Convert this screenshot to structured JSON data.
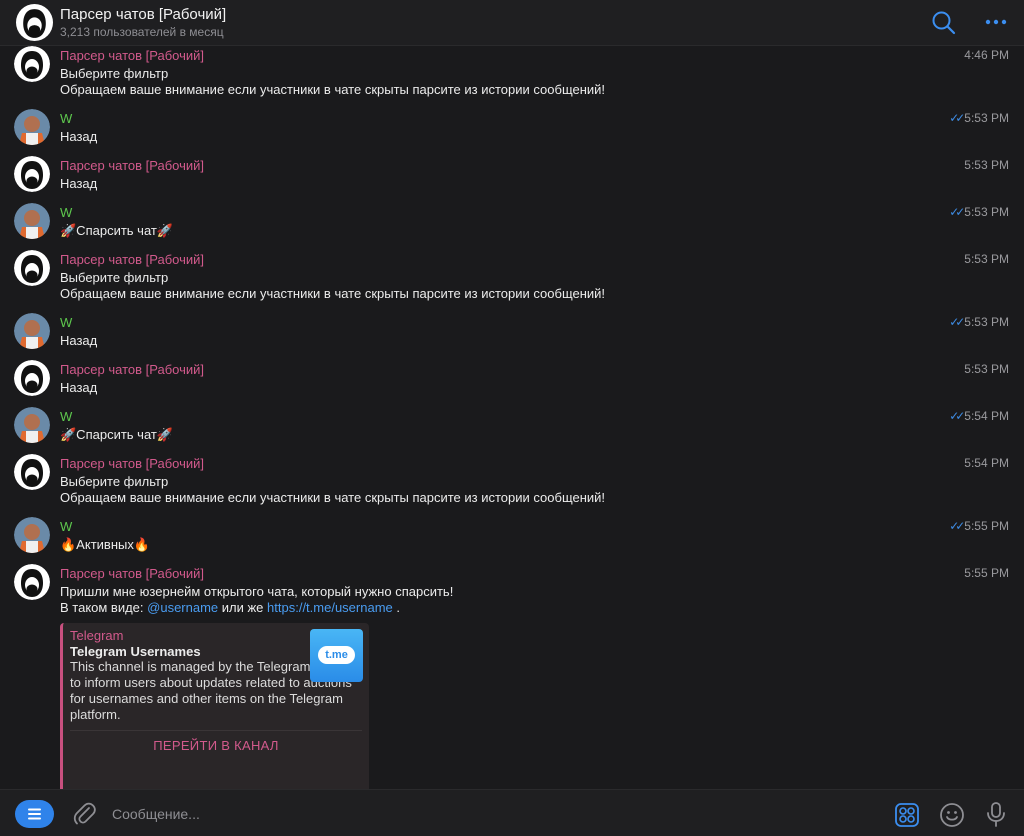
{
  "header": {
    "title": "Парсер чатов [Рабочий]",
    "subtitle": "3,213 пользователей в месяц",
    "icons": {
      "search": "search-icon",
      "more": "more-icon"
    }
  },
  "colors": {
    "accent": "#2f83ea",
    "bot_name": "#d25a8c",
    "user_name": "#5ec84e",
    "link": "#4a9cf0",
    "read_ticks": "#3e8ce4"
  },
  "messages": [
    {
      "sender": "Парсер чатов [Рабочий]",
      "time": "4:46 PM",
      "lines": [
        "Выберите фильтр",
        "Обращаем ваше внимание если участники в чате скрыты парсите из истории сообщений!"
      ]
    },
    {
      "sender": "W",
      "time": "5:53 PM",
      "lines": [
        "Назад"
      ]
    },
    {
      "sender": "Парсер чатов [Рабочий]",
      "time": "5:53 PM",
      "lines": [
        "Назад"
      ]
    },
    {
      "sender": "W",
      "time": "5:53 PM",
      "lines": [
        "🚀Спарсить чат🚀"
      ]
    },
    {
      "sender": "Парсер чатов [Рабочий]",
      "time": "5:53 PM",
      "lines": [
        "Выберите фильтр",
        "Обращаем ваше внимание если участники в чате скрыты парсите из истории сообщений!"
      ]
    },
    {
      "sender": "W",
      "time": "5:53 PM",
      "lines": [
        "Назад"
      ]
    },
    {
      "sender": "Парсер чатов [Рабочий]",
      "time": "5:53 PM",
      "lines": [
        "Назад"
      ]
    },
    {
      "sender": "W",
      "time": "5:54 PM",
      "lines": [
        "🚀Спарсить чат🚀"
      ]
    },
    {
      "sender": "Парсер чатов [Рабочий]",
      "time": "5:54 PM",
      "lines": [
        "Выберите фильтр",
        "Обращаем ваше внимание если участники в чате скрыты парсите из истории сообщений!"
      ]
    },
    {
      "sender": "W",
      "time": "5:55 PM",
      "lines": [
        "🔥Активных🔥"
      ]
    },
    {
      "sender": "Парсер чатов [Рабочий]",
      "time": "5:55 PM",
      "lines": [
        "Пришли мне юзернейм открытого чата, который нужно спарсить!"
      ],
      "line2": {
        "prefix": "В таком виде: ",
        "link1": "@username",
        "middle": " или же ",
        "link2": "https://t.me/username",
        "suffix": " ."
      }
    }
  ],
  "read_ticks": "✓✓",
  "preview": {
    "site": "Telegram",
    "title": "Telegram Usernames",
    "description": "This channel is managed by the Telegram team to inform users about updates related to auctions for usernames and other items on the Telegram platform.",
    "thumb_label": "t.me",
    "button": "ПЕРЕЙТИ В КАНАЛ"
  },
  "composer": {
    "placeholder": "Сообщение...",
    "icons": [
      "menu-icon",
      "paperclip-icon",
      "apps-icon",
      "emoji-icon",
      "microphone-icon"
    ]
  }
}
